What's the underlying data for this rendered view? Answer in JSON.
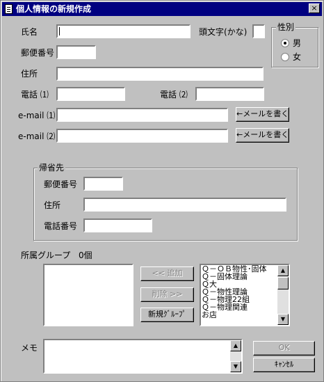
{
  "window": {
    "title": "個人情報の新規作成",
    "close": "×"
  },
  "form": {
    "name_label": "氏名",
    "kana_label": "頭文字(かな)",
    "gender_title": "性別",
    "gender_male": "男",
    "gender_female": "女",
    "gender_selected": "男",
    "postal_label": "郵便番号",
    "address_label": "住所",
    "phone1_label": "電話 ⑴",
    "phone2_label": "電話 ⑵",
    "email1_label": "e-mail ⑴",
    "email2_label": "e-mail ⑵",
    "write_mail_button": "←メールを書く"
  },
  "home": {
    "title": "帰省先",
    "postal_label": "郵便番号",
    "address_label": "住所",
    "phone_label": "電話番号"
  },
  "groups": {
    "label": "所属グループ",
    "count": "0個",
    "add_button": "<< 追加",
    "remove_button": "削除 >>",
    "new_group_button": "新規ｸﾞﾙｰﾌﾟ",
    "available": [
      "Ｑ－ＯＢ物性･固体",
      "Ｑ－固体理論",
      "Ｑ大",
      "Ｑ－物性理論",
      "Ｑ－物理22組",
      "Ｑ－物理関連",
      "お店"
    ]
  },
  "memo": {
    "label": "メモ"
  },
  "buttons": {
    "ok": "OK",
    "cancel": "ｷｬﾝｾﾙ"
  }
}
